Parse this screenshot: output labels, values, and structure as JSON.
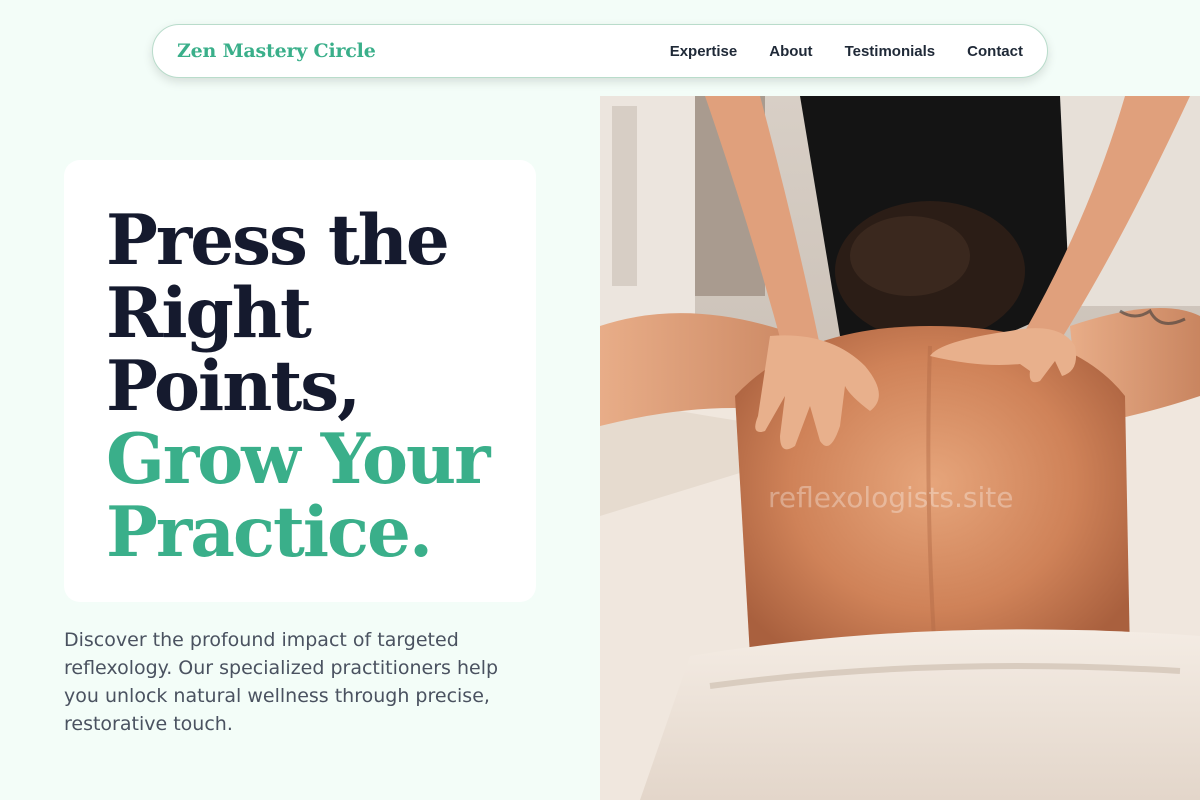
{
  "brand": {
    "name": "Zen Mastery Circle"
  },
  "nav": {
    "items": [
      {
        "label": "Expertise"
      },
      {
        "label": "About"
      },
      {
        "label": "Testimonials"
      },
      {
        "label": "Contact"
      }
    ]
  },
  "hero": {
    "headline_dark": [
      "Press the",
      "Right",
      "Points,"
    ],
    "headline_accent": [
      "Grow Your",
      "Practice."
    ],
    "description": "Discover the profound impact of targeted reflexology. Our specialized practitioners help you unlock natural wellness through precise, restorative touch."
  },
  "image": {
    "watermark": "reflexologists.site"
  },
  "colors": {
    "accent": "#3aaf8a",
    "heading": "#151a2e",
    "background": "#f3fdf8"
  }
}
